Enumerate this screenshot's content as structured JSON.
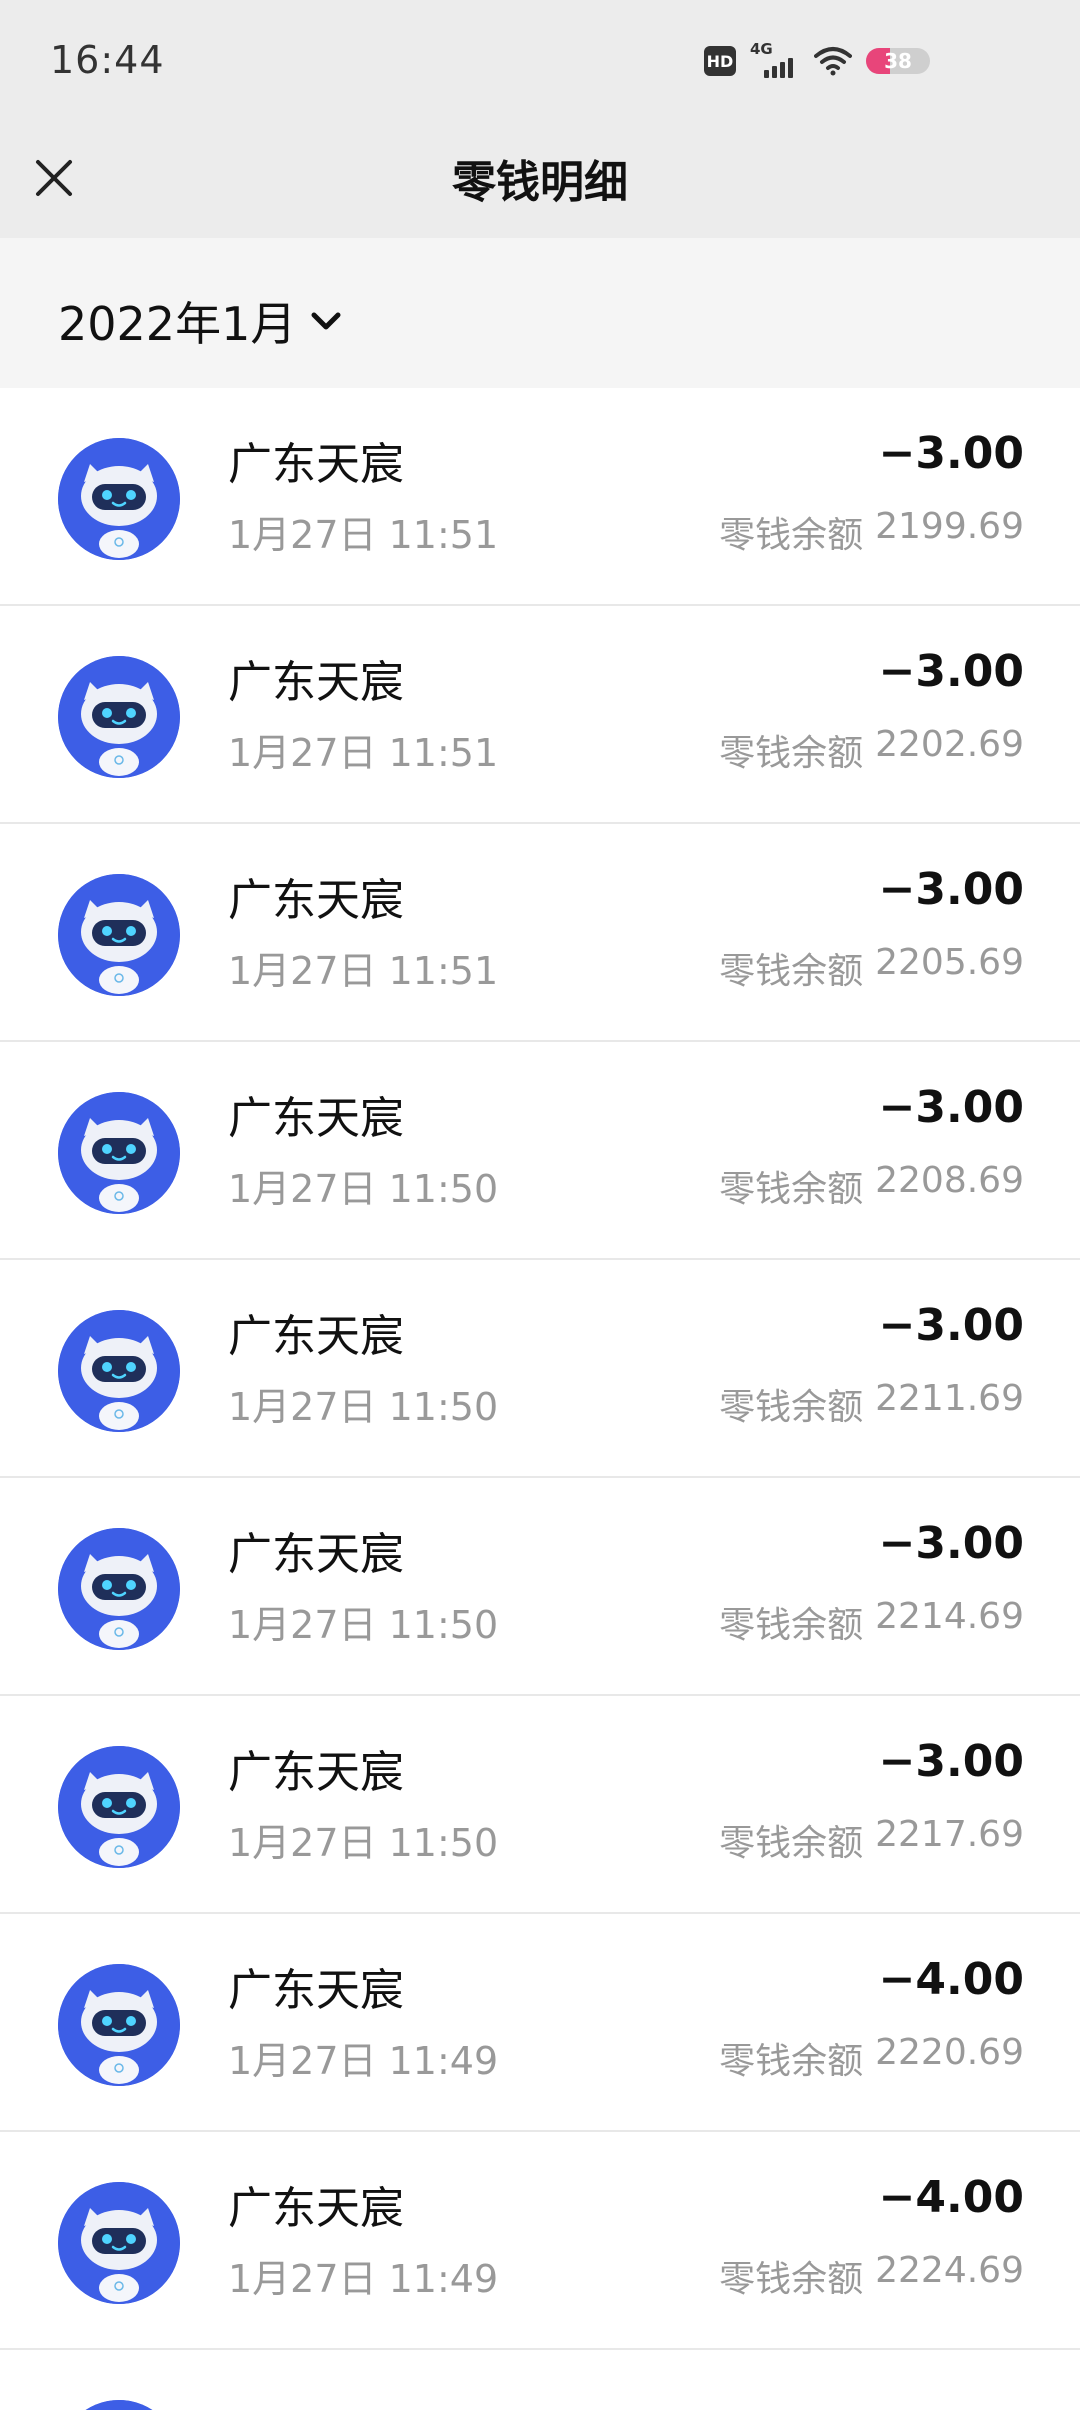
{
  "status": {
    "time": "16:44",
    "hd": "HD",
    "network": "4G",
    "battery": "38",
    "battery_level_percent": 38
  },
  "header": {
    "title": "零钱明细",
    "close_icon": "close-icon"
  },
  "filter": {
    "month": "2022年1月",
    "dropdown_icon": "chevron-down-icon"
  },
  "colors": {
    "header_bg": "#ececec",
    "filter_bg": "#f5f5f5",
    "avatar_blue": "#3d5ee6",
    "battery_accent": "#e8457a",
    "secondary_text": "#999999"
  },
  "transactions": [
    {
      "merchant": "广东天宸",
      "time": "1月27日 11:51",
      "amount": "−3.00",
      "balance_label": "零钱余额",
      "balance": "2199.69"
    },
    {
      "merchant": "广东天宸",
      "time": "1月27日 11:51",
      "amount": "−3.00",
      "balance_label": "零钱余额",
      "balance": "2202.69"
    },
    {
      "merchant": "广东天宸",
      "time": "1月27日 11:51",
      "amount": "−3.00",
      "balance_label": "零钱余额",
      "balance": "2205.69"
    },
    {
      "merchant": "广东天宸",
      "time": "1月27日 11:50",
      "amount": "−3.00",
      "balance_label": "零钱余额",
      "balance": "2208.69"
    },
    {
      "merchant": "广东天宸",
      "time": "1月27日 11:50",
      "amount": "−3.00",
      "balance_label": "零钱余额",
      "balance": "2211.69"
    },
    {
      "merchant": "广东天宸",
      "time": "1月27日 11:50",
      "amount": "−3.00",
      "balance_label": "零钱余额",
      "balance": "2214.69"
    },
    {
      "merchant": "广东天宸",
      "time": "1月27日 11:50",
      "amount": "−3.00",
      "balance_label": "零钱余额",
      "balance": "2217.69"
    },
    {
      "merchant": "广东天宸",
      "time": "1月27日 11:49",
      "amount": "−4.00",
      "balance_label": "零钱余额",
      "balance": "2220.69"
    },
    {
      "merchant": "广东天宸",
      "time": "1月27日 11:49",
      "amount": "−4.00",
      "balance_label": "零钱余额",
      "balance": "2224.69"
    }
  ],
  "avatar_icon": "robot-avatar-icon"
}
